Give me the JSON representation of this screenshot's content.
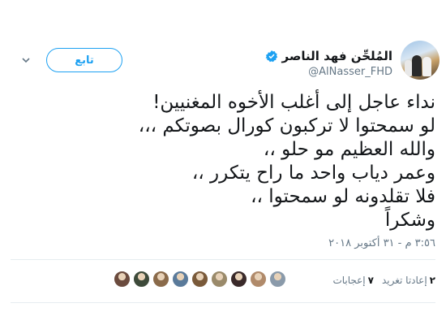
{
  "author": {
    "display_name": "المُلحِّن فهد الناصر",
    "handle": "@AlNasser_FHD",
    "verified": true
  },
  "follow_button": {
    "label": "تابع"
  },
  "tweet": {
    "text": "نداء عاجل إلى أغلب الأخوه المغنيين!\nلو سمحتوا لا تركبون كورال بصوتكم ،،،\nوالله العظيم مو حلو ،،\nوعمر دياب واحد ما راح يتكرر ،،\nفلا تقلدونه لو سمحتوا ،،\nوشكراً",
    "timestamp": "٣:٥٦ م - ٣١ أكتوبر ٢٠١٨"
  },
  "stats": {
    "retweets_count": "٢",
    "retweets_label": "إعادتا تغريد",
    "likes_count": "٧",
    "likes_label": "إعجابات"
  },
  "likers": [
    {
      "color": "#6b4b3e"
    },
    {
      "color": "#3d4a3a"
    },
    {
      "color": "#8a6a4a"
    },
    {
      "color": "#5a7a9a"
    },
    {
      "color": "#7a5a3a"
    },
    {
      "color": "#9a8a6a"
    },
    {
      "color": "#3a2a2a"
    },
    {
      "color": "#b08a6a"
    },
    {
      "color": "#8a9aaa"
    }
  ],
  "colors": {
    "accent": "#1da1f2",
    "secondary_text": "#657786",
    "primary_text": "#14171a"
  }
}
